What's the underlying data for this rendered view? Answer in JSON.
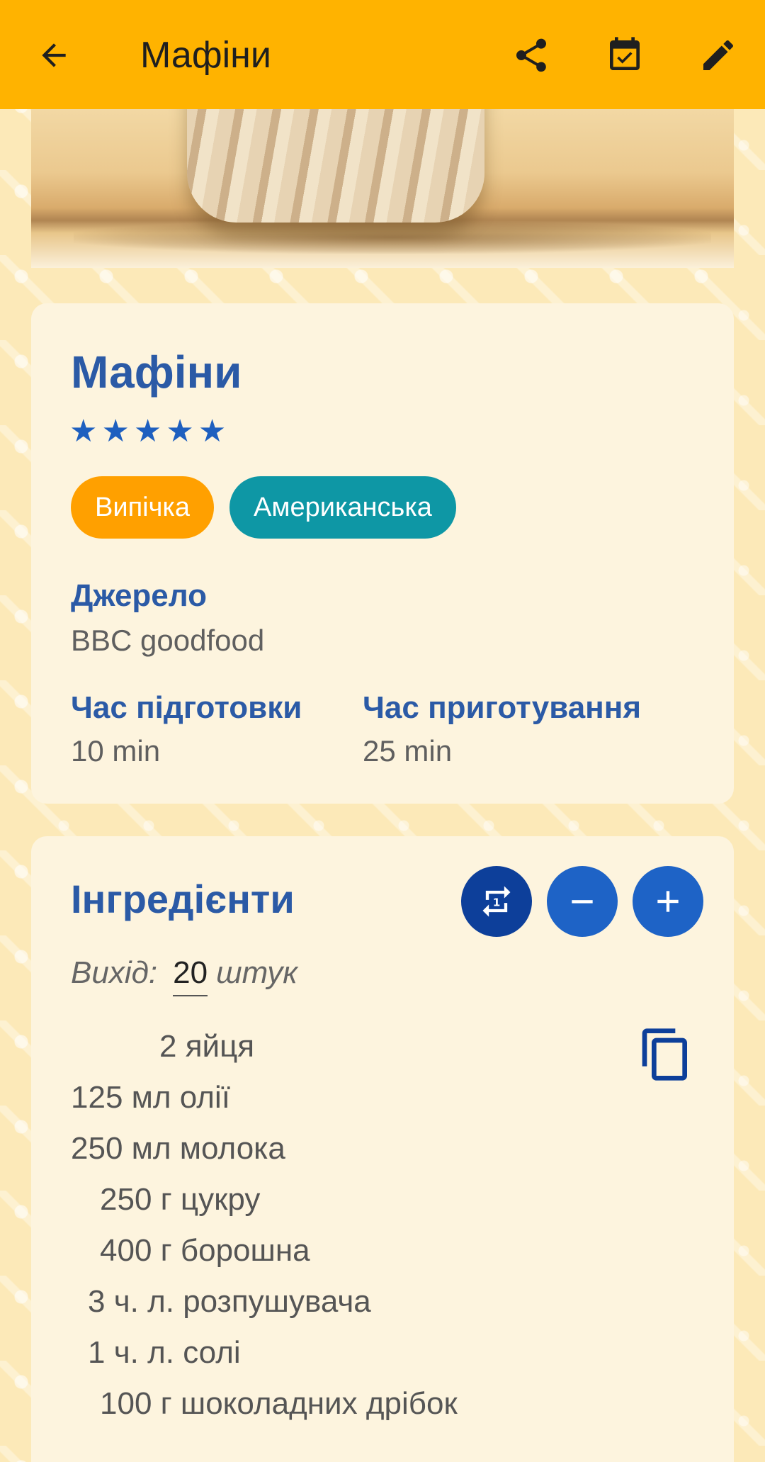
{
  "appbar": {
    "title": "Мафіни",
    "icons": [
      "arrow-back-icon",
      "share-icon",
      "calendar-check-icon",
      "edit-pencil-icon"
    ]
  },
  "recipe": {
    "title": "Мафіни",
    "rating": 5,
    "rating_max": 5,
    "tags": [
      "Випічка",
      "Американська"
    ],
    "source_label": "Джерело",
    "source_value": "BBC goodfood",
    "prep_label": "Час підготовки",
    "prep_value": "10 min",
    "cook_label": "Час приготування",
    "cook_value": "25 min"
  },
  "ingredients": {
    "title": "Інгредієнти",
    "yield_label": "Вихід:",
    "yield_value": "20",
    "yield_unit": "штук",
    "items": [
      "2 яйця",
      "125 мл олії",
      "250 мл молока",
      "250 г цукру",
      "400 г борошна",
      "3 ч. л. розпушувача",
      "1 ч. л. солі",
      "100 г шоколадних дрібок"
    ]
  },
  "colors": {
    "appbar": "#FFB300",
    "title_blue": "#2B5AA6",
    "star_blue": "#1E5FBF",
    "chip_orange": "#FFA000",
    "chip_teal": "#0E97A5",
    "button_dark_blue": "#0D3F9A",
    "button_blue": "#1E63C6",
    "card_bg": "#FDF4DE",
    "page_bg": "#FCE9B8"
  }
}
